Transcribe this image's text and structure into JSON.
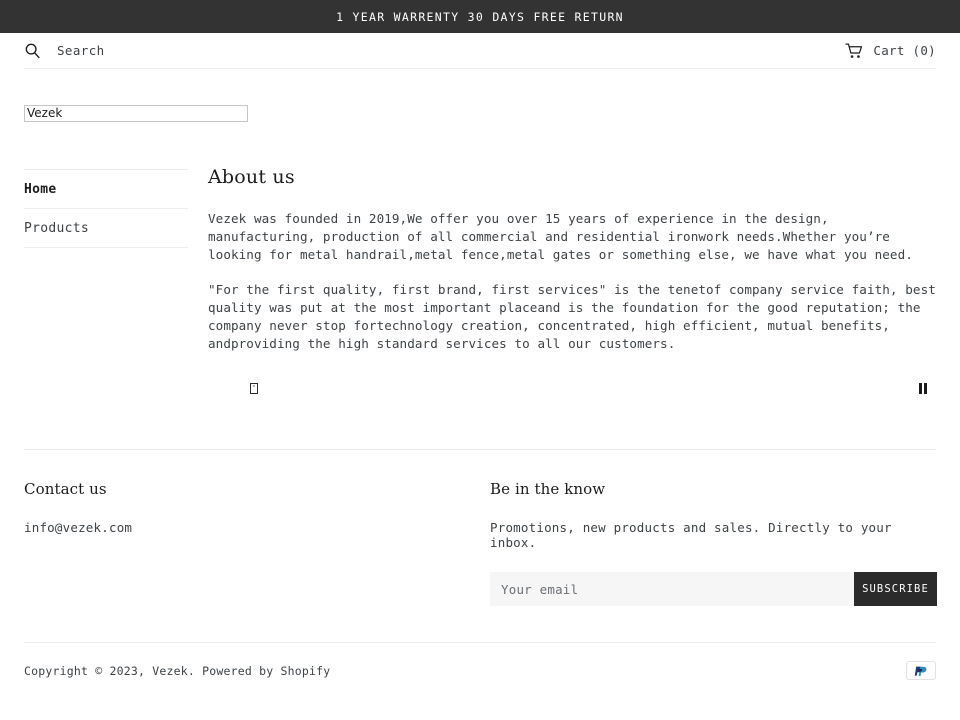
{
  "announcement": {
    "text": "1 YEAR WARRENTY 30 DAYS FREE RETURN",
    "background": "#333333",
    "color": "#ffffff"
  },
  "header": {
    "search_label": "Search",
    "search_placeholder": "Search",
    "search_icon": "search-icon",
    "cart_label": "Cart (0)",
    "cart_count": 0,
    "cart_icon": "cart-icon"
  },
  "logo": {
    "alt_text": "Vezek",
    "state": "broken-image-placeholder"
  },
  "sidebar": {
    "items": [
      {
        "label": "Home",
        "active": true
      },
      {
        "label": "Products",
        "active": false
      }
    ]
  },
  "main": {
    "title": "About us",
    "paragraphs": [
      "Vezek was founded in 2019,We offer you over 15 years of experience in the design, manufacturing, production of all commercial and residential ironwork needs.Whether you’re looking for metal handrail,metal fence,metal gates or something else, we have what you need.",
      "\"For the first quality, first brand, first services\" is the tenetof company service faith, best quality was put at the most important placeand is the foundation for the good reputation; the company never stop fortechnology creation, concentrated, high efficient, mutual benefits, andproviding the high standard services to all our customers."
    ],
    "slideshow": {
      "missing_glyph": "☒",
      "pause_label": "Pause slideshow",
      "pause_icon": "pause-icon"
    }
  },
  "footer": {
    "contact": {
      "title": "Contact us",
      "email": "info@vezek.com"
    },
    "newsletter": {
      "title": "Be in the know",
      "description": "Promotions, new products and sales. Directly to your inbox.",
      "email_value": "",
      "email_placeholder": "Your email",
      "subscribe_label": "SUBSCRIBE",
      "button_color": "#2b2b2b"
    }
  },
  "bottom_bar": {
    "copyright": "Copyright © 2023, Vezek. Powered by Shopify",
    "payment_icons": [
      {
        "name": "paypal-icon",
        "label": "PayPal",
        "color": "#003087"
      }
    ]
  }
}
